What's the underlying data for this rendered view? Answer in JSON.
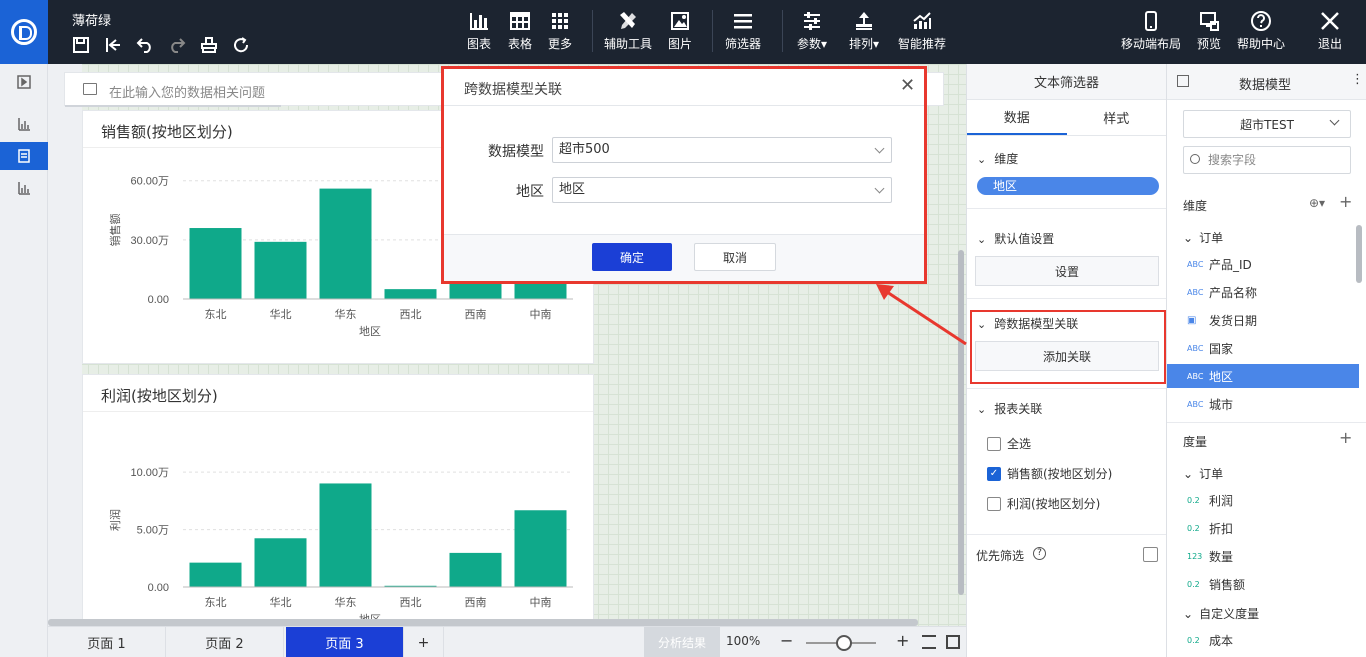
{
  "app": {
    "doc_title": "薄荷绿"
  },
  "toolbar": {
    "tools": [
      {
        "label": "图表",
        "icon": "bar-chart-icon"
      },
      {
        "label": "表格",
        "icon": "table-icon"
      },
      {
        "label": "更多",
        "icon": "grid-icon"
      },
      {
        "label": "辅助工具",
        "icon": "tools-icon"
      },
      {
        "label": "图片",
        "icon": "image-icon"
      },
      {
        "label": "筛选器",
        "icon": "filter-icon"
      },
      {
        "label": "参数▾",
        "icon": "sliders-icon"
      },
      {
        "label": "排列▾",
        "icon": "align-icon"
      },
      {
        "label": "智能推荐",
        "icon": "trend-icon"
      },
      {
        "label": "移动端布局",
        "icon": "mobile-icon"
      },
      {
        "label": "预览",
        "icon": "preview-icon"
      },
      {
        "label": "帮助中心",
        "icon": "help-icon"
      },
      {
        "label": "退出",
        "icon": "close-icon"
      }
    ]
  },
  "ask": {
    "placeholder": "在此输入您的数据相关问题"
  },
  "charts": {
    "sales_title": "销售额(按地区划分)",
    "profit_title": "利润(按地区划分)"
  },
  "chart_data": [
    {
      "type": "bar",
      "title": "销售额(按地区划分)",
      "xlabel": "地区",
      "ylabel": "销售额",
      "categories": [
        "东北",
        "华北",
        "华东",
        "西北",
        "西南",
        "中南"
      ],
      "values": [
        360000,
        290000,
        560000,
        50000,
        250000,
        300000
      ],
      "yticks": [
        "0.00",
        "30.00万",
        "60.00万"
      ],
      "ylim": [
        0,
        700000
      ],
      "color": "#0fa98a"
    },
    {
      "type": "bar",
      "title": "利润(按地区划分)",
      "xlabel": "地区",
      "ylabel": "利润",
      "categories": [
        "东北",
        "华北",
        "华东",
        "西北",
        "西南",
        "中南"
      ],
      "values": [
        20000,
        40000,
        85000,
        1000,
        28000,
        63000
      ],
      "yticks": [
        "0.00",
        "5.00万",
        "10.00万"
      ],
      "ylim": [
        0,
        110000
      ],
      "color": "#0fa98a"
    }
  ],
  "pages": {
    "tabs": [
      "页面 1",
      "页面 2",
      "页面 3"
    ],
    "add": "+",
    "analysis": "分析结果",
    "zoom": "100%"
  },
  "filter_panel": {
    "title": "文本筛选器",
    "tabs": [
      "数据",
      "样式"
    ],
    "dimension_title": "维度",
    "dimension_value": "地区",
    "default_title": "默认值设置",
    "default_button": "设置",
    "cross_title": "跨数据模型关联",
    "cross_button": "添加关联",
    "report_title": "报表关联",
    "report_items": [
      {
        "label": "全选",
        "checked": false
      },
      {
        "label": "销售额(按地区划分)",
        "checked": true
      },
      {
        "label": "利润(按地区划分)",
        "checked": false
      }
    ],
    "priority": "优先筛选"
  },
  "model_panel": {
    "title": "数据模型",
    "model_select": "超市TEST",
    "search_placeholder": "搜索字段",
    "dim_head": "维度",
    "dim_group": "订单",
    "dims": [
      {
        "type": "ABC",
        "label": "产品_ID"
      },
      {
        "type": "ABC",
        "label": "产品名称"
      },
      {
        "type": "date",
        "label": "发货日期"
      },
      {
        "type": "ABC",
        "label": "国家"
      },
      {
        "type": "ABC",
        "label": "地区"
      },
      {
        "type": "ABC",
        "label": "城市"
      }
    ],
    "measure_head": "度量",
    "measure_group": "订单",
    "measures": [
      {
        "type": "0.2",
        "label": "利润"
      },
      {
        "type": "0.2",
        "label": "折扣"
      },
      {
        "type": "123",
        "label": "数量"
      },
      {
        "type": "0.2",
        "label": "销售额"
      }
    ],
    "custom_group": "自定义度量",
    "custom": [
      {
        "type": "0.2",
        "label": "成本"
      }
    ]
  },
  "dialog": {
    "title": "跨数据模型关联",
    "model_label": "数据模型",
    "model_value": "超市500",
    "region_label": "地区",
    "region_value": "地区",
    "ok": "确定",
    "cancel": "取消"
  },
  "colors": {
    "accent": "#1b63d6",
    "highlight": "#e8382e",
    "bar": "#0fa98a"
  }
}
